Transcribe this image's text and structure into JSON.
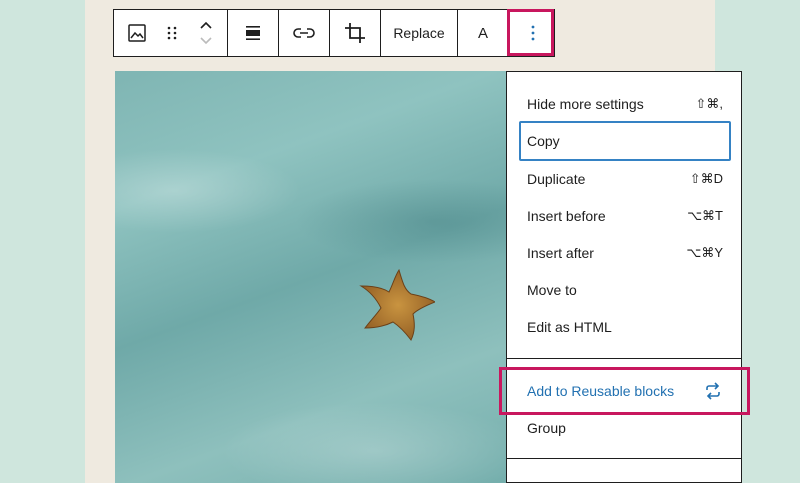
{
  "toolbar": {
    "replace_label": "Replace",
    "text_button_label": "A"
  },
  "menu": {
    "items": [
      {
        "label": "Hide more settings",
        "shortcut": "⇧⌘,"
      },
      {
        "label": "Copy",
        "shortcut": ""
      },
      {
        "label": "Duplicate",
        "shortcut": "⇧⌘D"
      },
      {
        "label": "Insert before",
        "shortcut": "⌥⌘T"
      },
      {
        "label": "Insert after",
        "shortcut": "⌥⌘Y"
      },
      {
        "label": "Move to",
        "shortcut": ""
      },
      {
        "label": "Edit as HTML",
        "shortcut": ""
      },
      {
        "label": "Add to Reusable blocks",
        "shortcut": ""
      },
      {
        "label": "Group",
        "shortcut": ""
      }
    ]
  },
  "colors": {
    "highlight": "#c8175e",
    "focus_ring": "#3582c4",
    "link_blue": "#2271b1",
    "background": "#cfe6dd"
  }
}
